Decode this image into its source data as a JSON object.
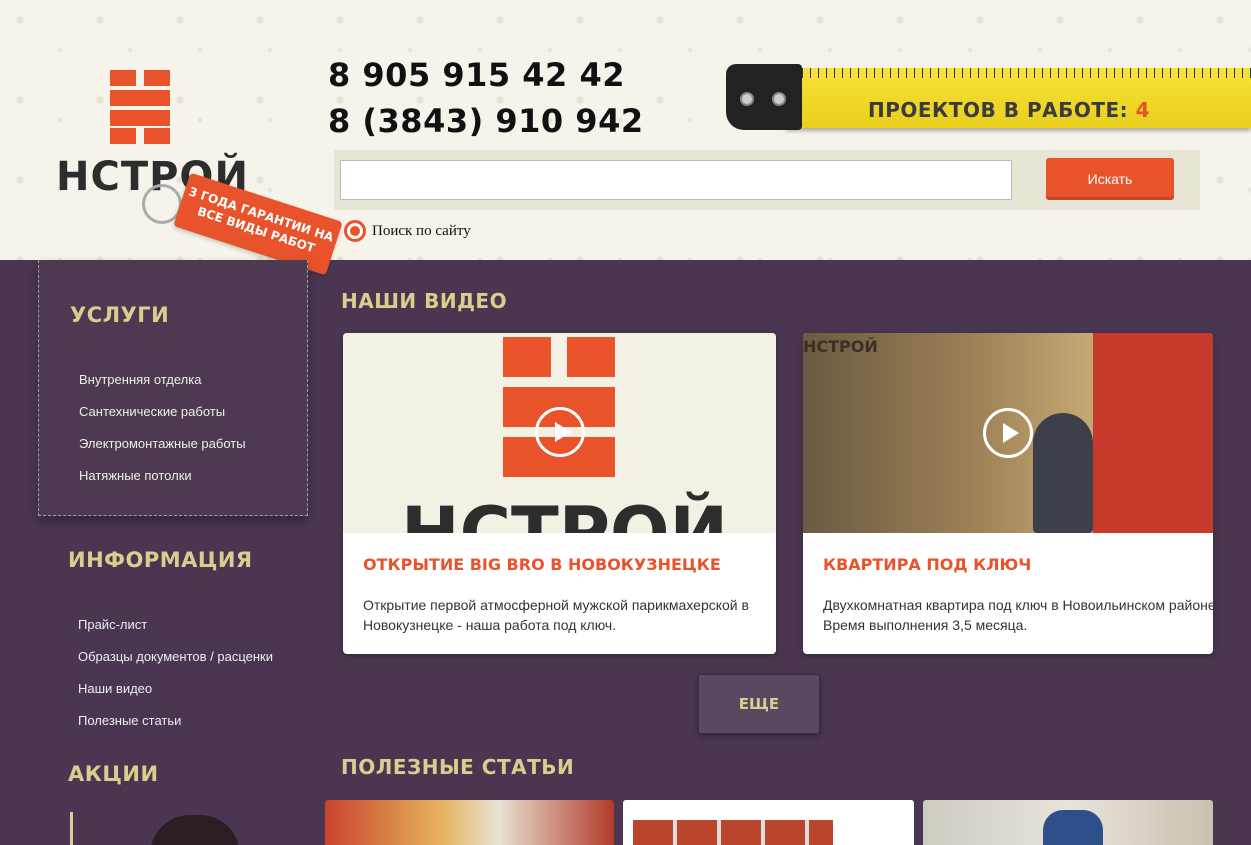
{
  "header": {
    "logo_text": "НСТРОЙ",
    "ribbon_text": "3 ГОДА ГАРАНТИИ НА ВСЕ ВИДЫ РАБОТ",
    "phones": [
      "8 905 915 42 42",
      "8 (3843) 910 942"
    ],
    "projects_label": "ПРОЕКТОВ В РАБОТЕ:",
    "projects_count": "4"
  },
  "search": {
    "value": "",
    "button_label": "Искать",
    "scope_label": "Поиск по сайту"
  },
  "sidebar": {
    "services_heading": "УСЛУГИ",
    "services": [
      "Внутренняя отделка",
      "Сантехнические работы",
      "Электромонтажные работы",
      "Натяжные потолки"
    ],
    "info_heading": "ИНФОРМАЦИЯ",
    "info": [
      "Прайс-лист",
      "Образцы документов / расценки",
      "Наши видео",
      "Полезные статьи"
    ],
    "promo_heading": "АКЦИИ"
  },
  "main": {
    "videos_title": "НАШИ ВИДЕО",
    "videos": [
      {
        "title": "ОТКРЫТИЕ BIG BRO В НОВОКУЗНЕЦКЕ",
        "description": "Открытие первой атмосферной мужской парикмахерской в Новокузнецке - наша работа под ключ.",
        "thumb_text": "НСТРОЙ"
      },
      {
        "title": "КВАРТИРА ПОД КЛЮЧ",
        "description": "Двухкомнатная квартира под ключ в Новоильинском районе. Время выполнения 3,5 месяца.",
        "thumb_text": "НСТРОЙ"
      }
    ],
    "more_label": "ЕЩЕ",
    "articles_title": "ПОЛЕЗНЫЕ СТАТЬИ"
  },
  "colors": {
    "accent": "#e8532b",
    "background": "#4a3650",
    "heading": "#d7cf8e"
  }
}
